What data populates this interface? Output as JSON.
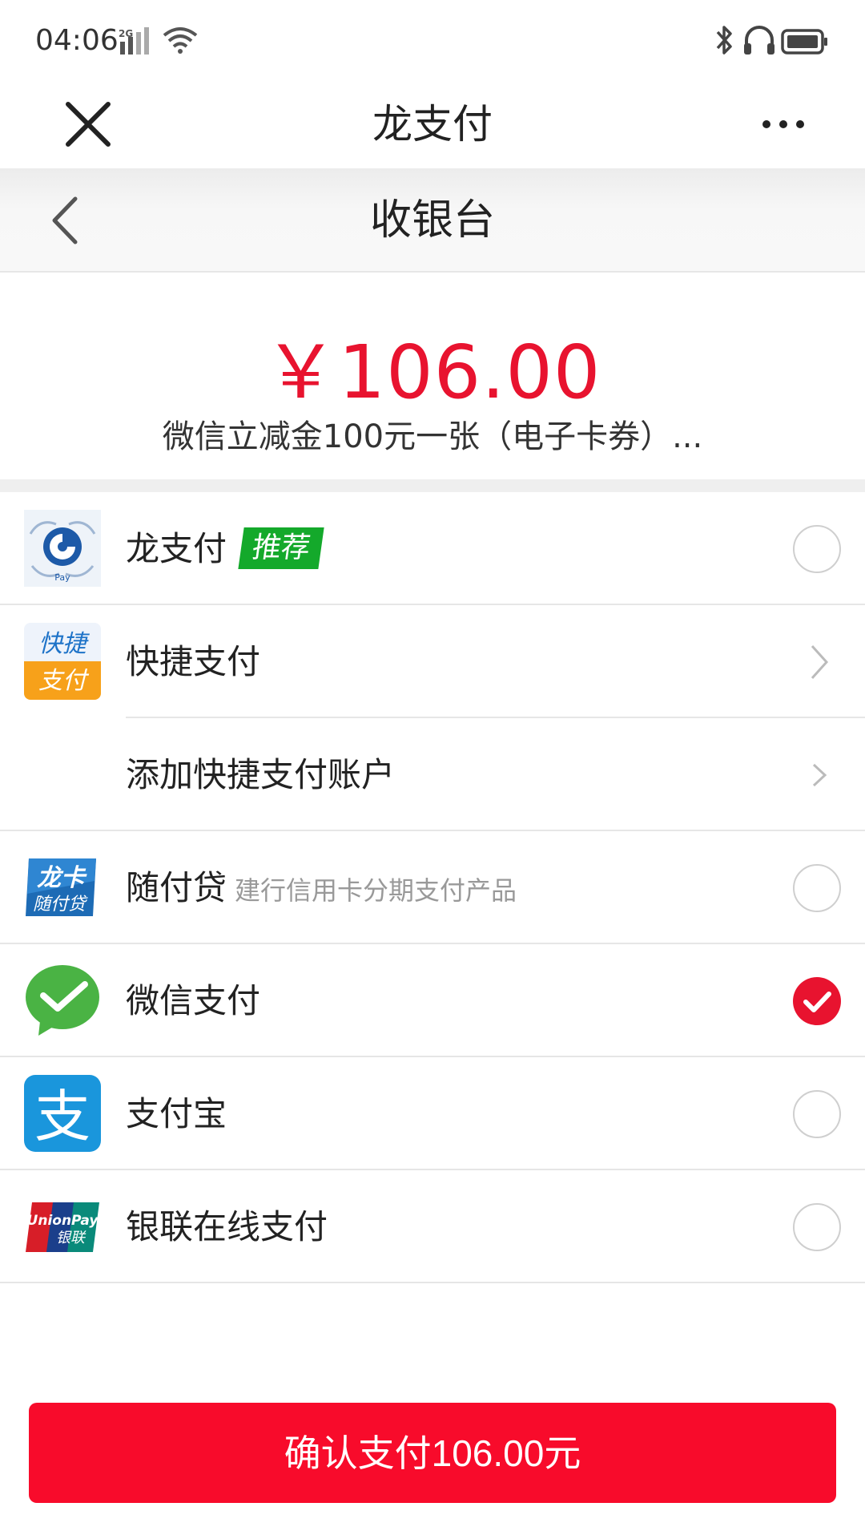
{
  "status_bar": {
    "time": "04:06",
    "network": "2G"
  },
  "top_bar": {
    "title": "龙支付",
    "close_icon": "close-icon",
    "more_icon": "more-icon"
  },
  "cashier": {
    "title": "收银台",
    "back_icon": "back-icon"
  },
  "order": {
    "amount": "￥106.00",
    "description": "微信立减金100元一张（电子卡券）..."
  },
  "payment_methods": [
    {
      "name": "龙支付",
      "badge": "推荐",
      "control": "radio",
      "selected": false,
      "logo": "ccb-longpay-logo"
    },
    {
      "name": "快捷支付",
      "control": "chevron",
      "logo": "kuaijie-pay-logo",
      "logo_text_top": "快捷",
      "logo_text_bottom": "支付"
    },
    {
      "name": "添加快捷支付账户",
      "control": "chevron"
    },
    {
      "name": "随付贷",
      "subtitle": "建行信用卡分期支付产品",
      "control": "radio",
      "selected": false,
      "logo": "longka-suifudai-logo"
    },
    {
      "name": "微信支付",
      "control": "radio",
      "selected": true,
      "logo": "wechat-pay-logo"
    },
    {
      "name": "支付宝",
      "control": "radio",
      "selected": false,
      "logo": "alipay-logo"
    },
    {
      "name": "银联在线支付",
      "control": "radio",
      "selected": false,
      "logo": "unionpay-logo"
    }
  ],
  "confirm_button": {
    "label": "确认支付106.00元"
  },
  "colors": {
    "accent_red": "#e8132f",
    "button_red": "#f80b2b",
    "badge_green": "#14a92b",
    "wechat_green": "#4ab344",
    "alipay_blue": "#1a96dc"
  }
}
